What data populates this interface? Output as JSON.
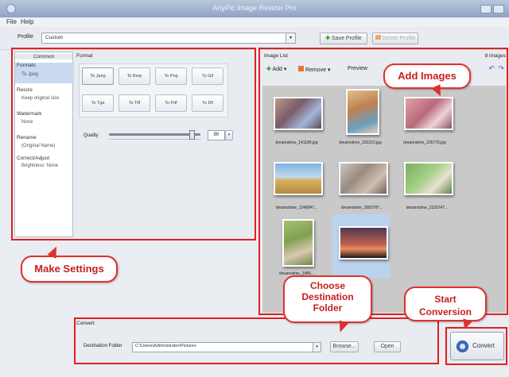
{
  "window": {
    "title": "AnyPic Image Resizer Pro"
  },
  "menu": {
    "items": [
      "File",
      "Help"
    ]
  },
  "profile": {
    "label": "Profile",
    "value": "Custom",
    "save_label": "Save Profile",
    "delete_label": "Delete Profile"
  },
  "sidebar": {
    "header": "Common",
    "sections": [
      {
        "title": "Formats",
        "sub": "To Jpeg"
      },
      {
        "title": "Resize",
        "sub": "Keep original size"
      },
      {
        "title": "Watermark",
        "sub": "None"
      },
      {
        "title": "Rename",
        "sub": "(Original Name)"
      },
      {
        "title": "Correct/Adjust",
        "sub": "Brightness: None"
      }
    ]
  },
  "settings": {
    "header": "Format",
    "formats": [
      "To Jpeg",
      "To Bmp",
      "To Png",
      "To Gif",
      "To Tga",
      "To Tiff",
      "To Pdf",
      "To Dll"
    ],
    "quality_label": "Quality",
    "quality_value": "90",
    "quality_level": 0.9
  },
  "image_list": {
    "header": "Image List",
    "count": "8 images",
    "add_label": "Add",
    "remove_label": "Remove",
    "preview_label": "Preview",
    "files": [
      "dreamstime_141189.jpg",
      "dreamstime_181210.jpg",
      "dreamstime_226776.jpg",
      "dreamstime_1248047...",
      "dreamstime_2683787...",
      "dreamstime_2193747...",
      "dreamstime_3486...",
      ""
    ]
  },
  "convert": {
    "header": "Convert",
    "dest_label": "Destination Folder",
    "dest_value": "C:\\Users\\Administrator\\Pictures",
    "browse_label": "Browse...",
    "open_label": "Open",
    "convert_label": "Convert"
  },
  "callouts": {
    "add_images": "Add Images",
    "make_settings": "Make Settings",
    "choose_destination": "Choose\nDestination\nFolder",
    "start_conversion": "Start\nConversion"
  },
  "colors": {
    "annotation_red": "#e02020",
    "callout_text": "#c81e1e",
    "convert_blue": "#3a6fc0"
  }
}
